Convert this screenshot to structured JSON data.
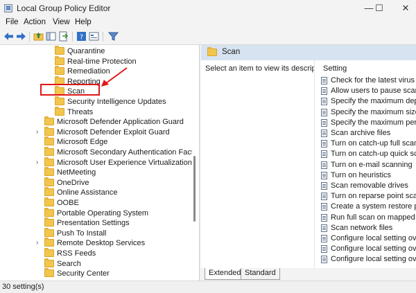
{
  "window": {
    "title": "Local Group Policy Editor",
    "minimize": "—",
    "maximize": "☐",
    "close": "✕"
  },
  "menu": [
    "File",
    "Action",
    "View",
    "Help"
  ],
  "tree": {
    "items": [
      {
        "label": "Quarantine",
        "indent": 1,
        "expander": false
      },
      {
        "label": "Real-time Protection",
        "indent": 1,
        "expander": false
      },
      {
        "label": "Remediation",
        "indent": 1,
        "expander": false
      },
      {
        "label": "Reporting",
        "indent": 1,
        "expander": false
      },
      {
        "label": "Scan",
        "indent": 1,
        "expander": false,
        "selected": true
      },
      {
        "label": "Security Intelligence Updates",
        "indent": 1,
        "expander": false
      },
      {
        "label": "Threats",
        "indent": 1,
        "expander": false
      },
      {
        "label": "Microsoft Defender Application Guard",
        "indent": 0,
        "expander": false
      },
      {
        "label": "Microsoft Defender Exploit Guard",
        "indent": 0,
        "expander": true
      },
      {
        "label": "Microsoft Edge",
        "indent": 0,
        "expander": false
      },
      {
        "label": "Microsoft Secondary Authentication Factor",
        "indent": 0,
        "expander": false
      },
      {
        "label": "Microsoft User Experience Virtualization",
        "indent": 0,
        "expander": true
      },
      {
        "label": "NetMeeting",
        "indent": 0,
        "expander": false
      },
      {
        "label": "OneDrive",
        "indent": 0,
        "expander": false
      },
      {
        "label": "Online Assistance",
        "indent": 0,
        "expander": false
      },
      {
        "label": "OOBE",
        "indent": 0,
        "expander": false
      },
      {
        "label": "Portable Operating System",
        "indent": 0,
        "expander": false
      },
      {
        "label": "Presentation Settings",
        "indent": 0,
        "expander": false
      },
      {
        "label": "Push To Install",
        "indent": 0,
        "expander": false
      },
      {
        "label": "Remote Desktop Services",
        "indent": 0,
        "expander": true
      },
      {
        "label": "RSS Feeds",
        "indent": 0,
        "expander": false
      },
      {
        "label": "Search",
        "indent": 0,
        "expander": false
      },
      {
        "label": "Security Center",
        "indent": 0,
        "expander": false
      }
    ]
  },
  "right": {
    "header": "Scan",
    "description": "Select an item to view its description.",
    "column_header": "Setting",
    "settings": [
      "Check for the latest virus",
      "Allow users to pause scan",
      "Specify the maximum dep",
      "Specify the maximum size",
      "Specify the maximum per",
      "Scan archive files",
      "Turn on catch-up full scan",
      "Turn on catch-up quick sc",
      "Turn on e-mail scanning",
      "Turn on heuristics",
      "Scan removable drives",
      "Turn on reparse point sca",
      "Create a system restore po",
      "Run full scan on mapped",
      "Scan network files",
      "Configure local setting ov",
      "Configure local setting ov",
      "Configure local setting ov"
    ]
  },
  "tabs": [
    "Extended",
    "Standard"
  ],
  "status": "30 setting(s)",
  "colors": {
    "highlight": "#e01616",
    "header_bg": "#d7e3f1",
    "folder": "#f2c54d"
  }
}
